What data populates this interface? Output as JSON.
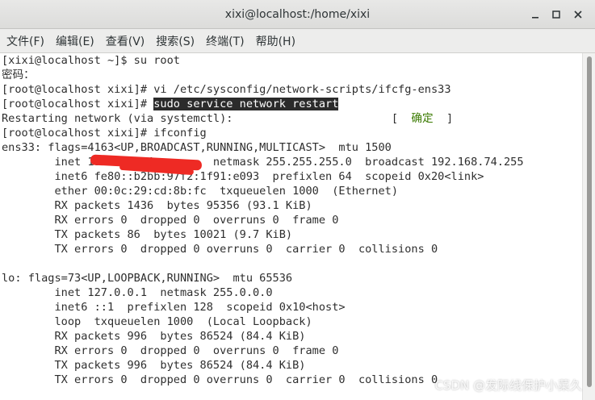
{
  "window": {
    "title": "xixi@localhost:/home/xixi"
  },
  "menu": [
    {
      "label": "文件(F)"
    },
    {
      "label": "编辑(E)"
    },
    {
      "label": "查看(V)"
    },
    {
      "label": "搜索(S)"
    },
    {
      "label": "终端(T)"
    },
    {
      "label": "帮助(H)"
    }
  ],
  "terminal": {
    "lines": [
      {
        "text": "[xixi@localhost ~]$ su root"
      },
      {
        "text": "密码："
      },
      {
        "text": "[root@localhost xixi]# vi /etc/sysconfig/network-scripts/ifcfg-ens33"
      },
      {
        "text": "[root@localhost xixi]# ",
        "highlight": "sudo service network restart"
      },
      {
        "text": "Restarting network (via systemctl):                        [  ",
        "status": "确定",
        "tail": "  ]"
      },
      {
        "text": "[root@localhost xixi]# ifconfig"
      },
      {
        "text": "ens33: flags=4163<UP,BROADCAST,RUNNING,MULTICAST>  mtu 1500"
      },
      {
        "text": "        inet 192.168.74.        netmask 255.255.255.0  broadcast 192.168.74.255"
      },
      {
        "text": "        inet6 fe80::b2bb:97f2:1f91:e093  prefixlen 64  scopeid 0x20<link>"
      },
      {
        "text": "        ether 00:0c:29:cd:8b:fc  txqueuelen 1000  (Ethernet)"
      },
      {
        "text": "        RX packets 1436  bytes 95356 (93.1 KiB)"
      },
      {
        "text": "        RX errors 0  dropped 0  overruns 0  frame 0"
      },
      {
        "text": "        TX packets 86  bytes 10021 (9.7 KiB)"
      },
      {
        "text": "        TX errors 0  dropped 0 overruns 0  carrier 0  collisions 0"
      },
      {
        "text": ""
      },
      {
        "text": "lo: flags=73<UP,LOOPBACK,RUNNING>  mtu 65536"
      },
      {
        "text": "        inet 127.0.0.1  netmask 255.0.0.0"
      },
      {
        "text": "        inet6 ::1  prefixlen 128  scopeid 0x10<host>"
      },
      {
        "text": "        loop  txqueuelen 1000  (Local Loopback)"
      },
      {
        "text": "        RX packets 996  bytes 86524 (84.4 KiB)"
      },
      {
        "text": "        RX errors 0  dropped 0  overruns 0  frame 0"
      },
      {
        "text": "        TX packets 996  bytes 86524 (84.4 KiB)"
      },
      {
        "text": "        TX errors 0  dropped 0 overruns 0  carrier 0  collisions 0"
      }
    ]
  },
  "watermark": "CSDN @发际线保护小菜久",
  "colors": {
    "status_ok": "#3a7a00",
    "highlight_bg": "#2b2b2b",
    "redaction": "#ee2a24"
  }
}
